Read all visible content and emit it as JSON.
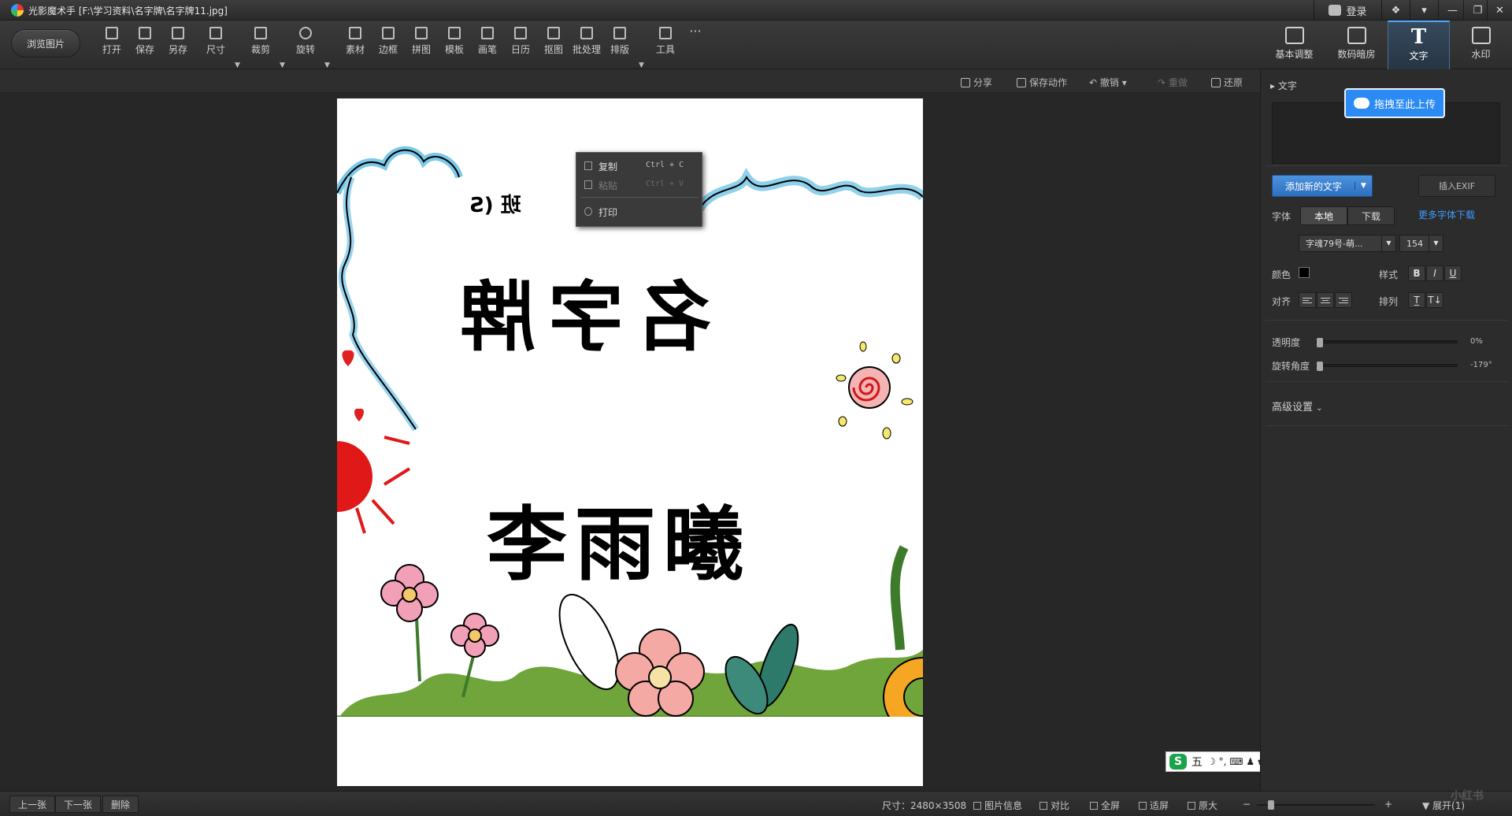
{
  "window": {
    "title": "光影魔术手  [F:\\学习资料\\名字牌\\名字牌11.jpg]",
    "login_label": "登录",
    "controls": [
      "❖",
      "▾",
      "—",
      "❐",
      "✕"
    ]
  },
  "toolbar": {
    "browse_label": "浏览图片",
    "tools": [
      "打开",
      "保存",
      "另存",
      "尺寸",
      "裁剪",
      "旋转",
      "素材",
      "边框",
      "拼图",
      "模板",
      "画笔",
      "日历",
      "抠图",
      "批处理",
      "排版",
      "工具"
    ],
    "more_label": "···"
  },
  "right_tabs": {
    "items": [
      "基本调整",
      "数码暗房",
      "文字",
      "水印"
    ],
    "active": "文字",
    "active_glyph": "T"
  },
  "actions": {
    "share": "分享",
    "save_action": "保存动作",
    "undo": "撤销",
    "redo": "重做",
    "restore": "还原"
  },
  "photo": {
    "mirrored_class": "班 (S",
    "mirrored_line1": "名字牌",
    "name": "李雨曦"
  },
  "context_menu": {
    "items": [
      {
        "label": "复制",
        "shortcut": "Ctrl + C",
        "enabled": true
      },
      {
        "label": "粘贴",
        "shortcut": "Ctrl + V",
        "enabled": false
      },
      {
        "label": "打印",
        "shortcut": "",
        "enabled": true
      }
    ]
  },
  "ime": {
    "logo": "S",
    "mode": "五",
    "icons": "☽ °, ⌨ ♟ ✿"
  },
  "panel": {
    "section_title": "文字",
    "cloud_upload": "拖拽至此上传",
    "add_text": "添加新的文字",
    "insert_exif": "插入EXIF",
    "font_label": "字体",
    "font_source": [
      "本地",
      "下载"
    ],
    "more_fonts": "更多字体下载",
    "font_name": "字魂79号-萌...",
    "font_size": "154",
    "color_label": "颜色",
    "text_color": "#000000",
    "style_label": "样式",
    "style_buttons": [
      "B",
      "I",
      "U"
    ],
    "align_label": "对齐",
    "arrange_label": "排列",
    "arrange_buttons": [
      "T̲",
      "T↓"
    ],
    "opacity_label": "透明度",
    "opacity_value": "0%",
    "opacity_level": 0,
    "rotation_label": "旋转角度",
    "rotation_value": "-179°",
    "rotation_level": 0,
    "advanced_label": "高级设置"
  },
  "statusbar": {
    "prev": "上一张",
    "next": "下一张",
    "delete": "删除",
    "size_text": "尺寸：2480×3508",
    "info": "图片信息",
    "compare": "对比",
    "fullscreen": "全屏",
    "fit": "适屏",
    "original": "原大",
    "minus": "−",
    "plus": "+",
    "expand": "展开(1)",
    "zoom_level": 0.1
  },
  "watermark": "小红书",
  "colors": {
    "accent": "#2b8af3",
    "active_tab": "#55aaff"
  }
}
